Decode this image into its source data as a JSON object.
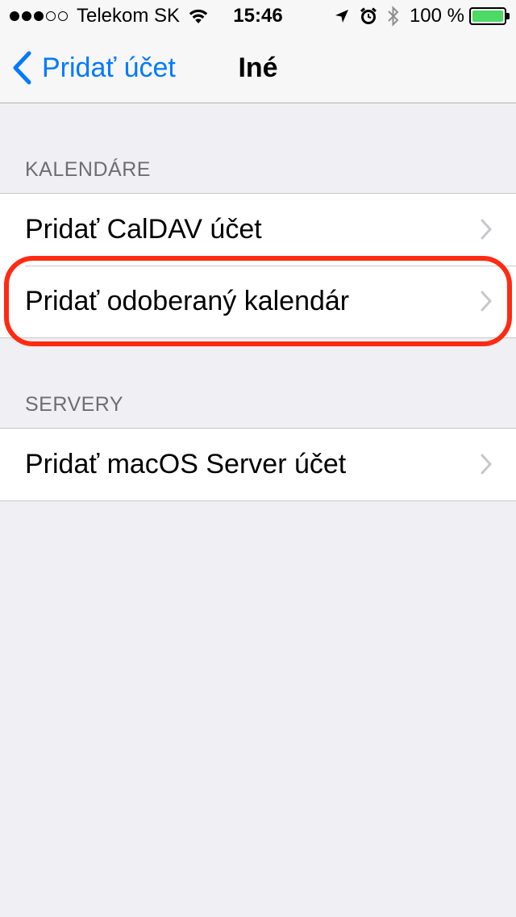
{
  "status_bar": {
    "carrier": "Telekom SK",
    "time": "15:46",
    "battery_percent": "100 %",
    "battery_level": 1.0,
    "signal_bars_filled": 3,
    "signal_bars_total": 5,
    "icons": [
      "wifi-icon",
      "location-arrow-icon",
      "alarm-icon",
      "bluetooth-icon",
      "battery-icon"
    ]
  },
  "nav": {
    "back_label": "Pridať účet",
    "title": "Iné"
  },
  "sections": [
    {
      "header": "KALENDÁRE",
      "rows": [
        {
          "label": "Pridať CalDAV účet"
        },
        {
          "label": "Pridať odoberaný kalendár"
        }
      ]
    },
    {
      "header": "SERVERY",
      "rows": [
        {
          "label": "Pridať macOS Server účet"
        }
      ]
    }
  ],
  "colors": {
    "accent": "#007aff",
    "highlight": "#ff2a12",
    "background": "#efeff4",
    "battery": "#4cd964"
  }
}
